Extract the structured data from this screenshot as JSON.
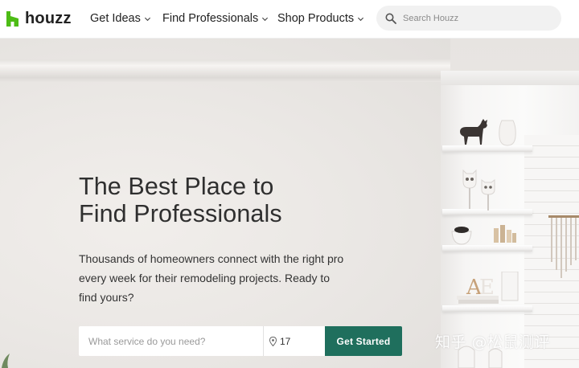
{
  "brand": {
    "name": "houzz",
    "color": "#4dbc15"
  },
  "nav": {
    "items": [
      {
        "label": "Get Ideas"
      },
      {
        "label": "Find Professionals"
      },
      {
        "label": "Shop Products"
      }
    ]
  },
  "search": {
    "placeholder": "Search Houzz",
    "icon": "search-icon"
  },
  "hero": {
    "headline_line1": "The Best Place to",
    "headline_line2": "Find Professionals",
    "sub_line1": "Thousands of homeowners connect with the right pro",
    "sub_line2": "every week for their remodeling projects. Ready to",
    "sub_line3": "find yours?",
    "service_placeholder": "What service do you need?",
    "zip_value": "17",
    "cta_label": "Get Started",
    "cta_color": "#1f6f5d"
  },
  "watermark": "知乎 @松鼠测评"
}
